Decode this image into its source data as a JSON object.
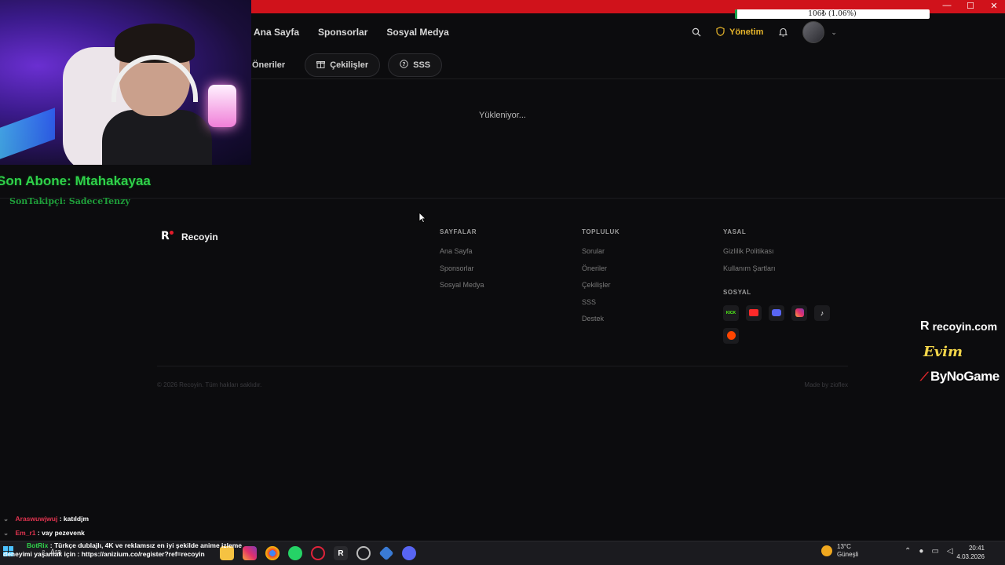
{
  "window": {
    "bandwidth_text": "106₺ (1.06%)",
    "bandwidth_percent": 1.06,
    "controls": [
      "—",
      "☐",
      "✕"
    ]
  },
  "header": {
    "nav": [
      "Ana Sayfa",
      "Sponsorlar",
      "Sosyal Medya"
    ],
    "admin_label": "Yönetim"
  },
  "chips": [
    {
      "label": "Öneriler",
      "icon": ""
    },
    {
      "label": "Çekilişler",
      "icon": "gift-icon"
    },
    {
      "label": "SSS",
      "icon": "help-circle-icon"
    }
  ],
  "main": {
    "loading_text": "Yükleniyor..."
  },
  "footer": {
    "brand": "Recoyin",
    "columns": [
      {
        "title": "SAYFALAR",
        "links": [
          "Ana Sayfa",
          "Sponsorlar",
          "Sosyal Medya"
        ]
      },
      {
        "title": "TOPLULUK",
        "links": [
          "Sorular",
          "Öneriler",
          "Çekilişler",
          "SSS",
          "Destek"
        ]
      },
      {
        "title": "YASAL",
        "links": [
          "Gizlilik Politikası",
          "Kullanım Şartları"
        ]
      }
    ],
    "social_title": "SOSYAL",
    "social": [
      {
        "name": "kick-icon",
        "glyph": "KICK",
        "color": "#53fc18"
      },
      {
        "name": "youtube-icon",
        "glyph": "▶",
        "color": "#ff2a2a"
      },
      {
        "name": "discord-icon",
        "glyph": "◉",
        "color": "#5865f2"
      },
      {
        "name": "instagram-icon",
        "glyph": "◎",
        "color": "#e1306c"
      },
      {
        "name": "tiktok-icon",
        "glyph": "♪",
        "color": "#ffffff"
      },
      {
        "name": "reddit-icon",
        "glyph": "●",
        "color": "#ff4500"
      }
    ],
    "copyright": "© 2026 Recoyin. Tüm hakları saklıdır.",
    "made_by": "Made by zioflex"
  },
  "stream_overlay": {
    "sub_text": "Son Abone: Mtahakayaa",
    "follow_text": "SonTakipçi: SadeceTenzy",
    "site": "recoyin.com",
    "evim": "Evim",
    "bynogame": "ByNoGame"
  },
  "chat": [
    {
      "user": "Araswuwjwuj",
      "msg": ": katıldjm",
      "color": "#e0334f"
    },
    {
      "user": "Em_r1",
      "msg": ": vay pezevenk",
      "color": "#e0334f"
    }
  ],
  "bot": {
    "name": "BotRix",
    "line1": ": Türkçe dublajlı, 4K ve reklamsız en iyi şekilde anime izleme",
    "line2": "deneyimi yaşamak için : https://anizium.co/register?ref=recoyin"
  },
  "taskbar": {
    "search": "Ara",
    "weather_temp": "13°C",
    "weather_desc": "Güneşli",
    "time": "20:41",
    "date": "4.03.2026"
  }
}
